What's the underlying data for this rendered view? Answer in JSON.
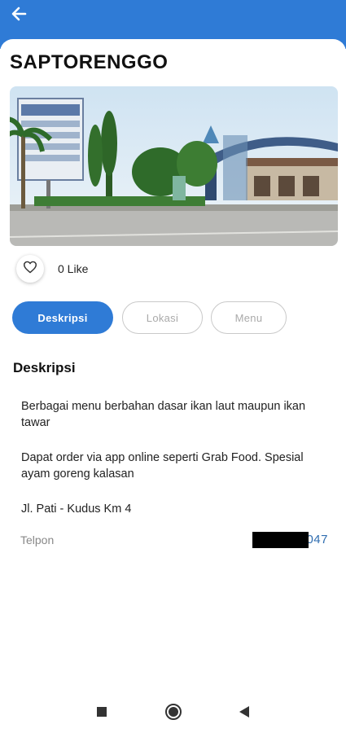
{
  "header": {
    "back_icon": "arrow-left-icon",
    "bar_color": "#2f7bd6"
  },
  "place": {
    "title": "SAPTORENGGO",
    "image_icon": "restaurant-photo"
  },
  "like": {
    "icon": "heart-outline-icon",
    "count_label": "0 Like"
  },
  "tabs": [
    {
      "label": "Deskripsi",
      "active": true
    },
    {
      "label": "Lokasi",
      "active": false
    },
    {
      "label": "Menu",
      "active": false
    }
  ],
  "description": {
    "heading": "Deskripsi",
    "paragraphs": [
      "Berbagai menu berbahan dasar ikan laut maupun ikan tawar",
      "Dapat order via app online seperti Grab Food. Spesial ayam goreng kalasan",
      "Jl. Pati - Kudus Km 4"
    ],
    "phone_label": "Telpon",
    "phone_value": "029        047"
  },
  "navbar": {
    "recents_icon": "square-icon",
    "home_icon": "circle-icon",
    "back_icon": "triangle-back-icon"
  },
  "colors": {
    "accent": "#2f7bd6",
    "phone_link": "#2f6db0"
  }
}
